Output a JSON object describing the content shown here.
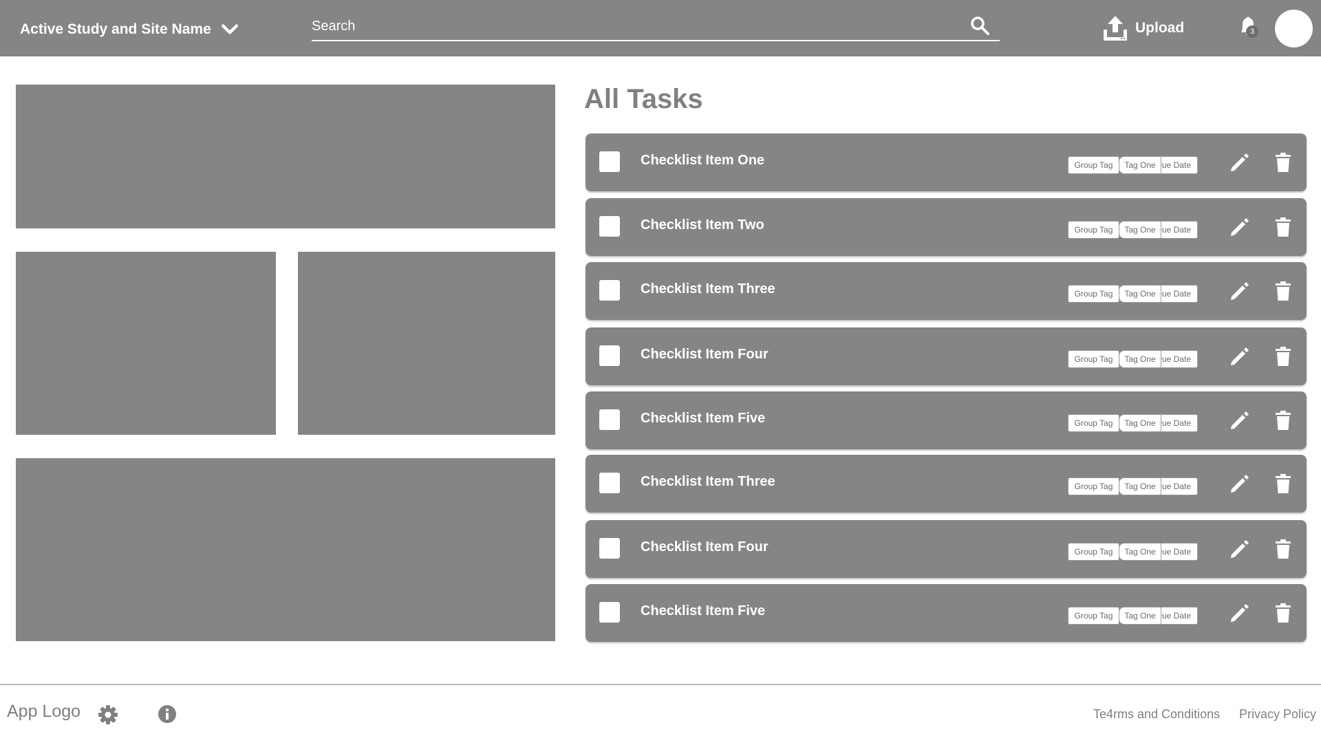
{
  "header": {
    "study_site_label": "Active Study and Site Name",
    "search_placeholder": "Search",
    "upload_label": "Upload",
    "notification_count": "3"
  },
  "main": {
    "title": "All Tasks",
    "tasks": [
      {
        "label": "Checklist Item One",
        "tags": [
          "Group Tag",
          "Tag One",
          "Due Date"
        ]
      },
      {
        "label": "Checklist Item Two",
        "tags": [
          "Group Tag",
          "Tag One",
          "Due Date"
        ]
      },
      {
        "label": "Checklist Item Three",
        "tags": [
          "Group Tag",
          "Tag One",
          "Due Date"
        ]
      },
      {
        "label": "Checklist Item Four",
        "tags": [
          "Group Tag",
          "Tag One",
          "Due Date"
        ]
      },
      {
        "label": "Checklist Item Five",
        "tags": [
          "Group Tag",
          "Tag One",
          "Due Date"
        ]
      },
      {
        "label": "Checklist Item Three",
        "tags": [
          "Group Tag",
          "Tag One",
          "Due Date"
        ]
      },
      {
        "label": "Checklist Item Four",
        "tags": [
          "Group Tag",
          "Tag One",
          "Due Date"
        ]
      },
      {
        "label": "Checklist Item Five",
        "tags": [
          "Group Tag",
          "Tag One",
          "Due Date"
        ]
      }
    ]
  },
  "footer": {
    "app_logo": "App Logo",
    "terms_link": "Te4rms and Conditions",
    "privacy_link": "Privacy Policy"
  },
  "colors": {
    "bar_gray": "#858585",
    "text_gray": "#808080",
    "white": "#ffffff"
  },
  "icons": [
    "chevron-down-icon",
    "search-icon",
    "upload-icon",
    "bell-icon",
    "avatar",
    "checkbox",
    "pencil-icon",
    "trash-icon",
    "gear-icon",
    "info-icon"
  ]
}
